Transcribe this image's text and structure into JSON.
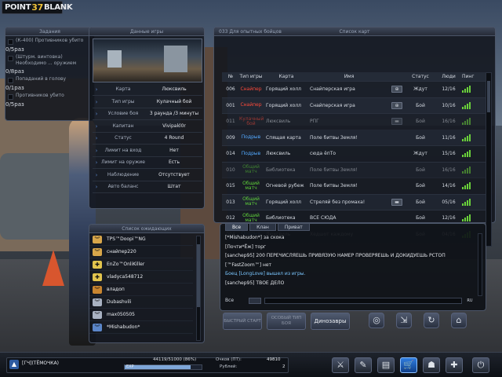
{
  "logo": {
    "left": "POINT",
    "num": "37",
    "right": "BLANK"
  },
  "missions": {
    "header": "Задания",
    "items": [
      {
        "text": "(К-400) Противников убито",
        "progress": "0/5раз"
      },
      {
        "text": "(Штурм. винтовка) Необходимо ... оружием",
        "progress": "0/8раз"
      },
      {
        "text": "Попаданий в голову",
        "progress": "0/1раз"
      },
      {
        "text": "Противников убито",
        "progress": "0/5раз"
      }
    ]
  },
  "gamedata": {
    "header": "Данные игры",
    "rows": [
      {
        "label": "Карта",
        "value": "Люксвиль"
      },
      {
        "label": "Тип игры",
        "value": "Кулачный бой"
      },
      {
        "label": "Условие боя",
        "value": "3 раунда /3 минуты"
      },
      {
        "label": "Капитан",
        "value": "Vivipakl0r"
      },
      {
        "label": "Статус",
        "value": "4 Round"
      },
      {
        "label": "Лимит на вход",
        "value": "Нет"
      },
      {
        "label": "Лимит на оружие",
        "value": "Есть"
      },
      {
        "label": "Наблюдение",
        "value": "Отсутствует"
      },
      {
        "label": "Авто баланс",
        "value": "Штат"
      }
    ]
  },
  "waiting": {
    "header": "Список ожидающих",
    "players": [
      {
        "rank_icon": "chevron-icon",
        "rank_color": "#d8a64a",
        "nick": "TPS™Doopi™NG"
      },
      {
        "rank_icon": "chevron-icon",
        "rank_color": "#d8a64a",
        "nick": "снайпер220"
      },
      {
        "rank_icon": "cross-icon",
        "rank_color": "#e2c44d",
        "nick": "EnZo™OnliKiller"
      },
      {
        "rank_icon": "cross-icon",
        "rank_color": "#e2c44d",
        "nick": "vladyca548712"
      },
      {
        "rank_icon": "chevron-icon",
        "rank_color": "#c9852f",
        "nick": "владоп"
      },
      {
        "rank_icon": "chevron-icon",
        "rank_color": "#a9b2c2",
        "nick": "Dubashvili"
      },
      {
        "rank_icon": "chevron-icon",
        "rank_color": "#a9b2c2",
        "nick": "max050505"
      },
      {
        "rank_icon": "chevron-icon",
        "rank_color": "#5b86c9",
        "nick": "*Mishabudon*"
      }
    ]
  },
  "rooms": {
    "server": "033 Для опытных бойцов",
    "header": "Список карт",
    "columns": [
      "№",
      "Тип игры",
      "Карта",
      "Имя",
      "Статус",
      "Люди",
      "Пинг"
    ],
    "rows": [
      {
        "num": "006",
        "mode": "Снайпер",
        "mode_color": "#ff4a3a",
        "map": "Горящий холл",
        "name": "Снайперская игра",
        "icon": "⊕",
        "status": "Ждут",
        "ppl": "12/16",
        "ping": 4,
        "dim": false
      },
      {
        "num": "001",
        "mode": "Снайпер",
        "mode_color": "#ff4a3a",
        "map": "Горящий холл",
        "name": "Снайперская игра",
        "icon": "⊕",
        "status": "Бой",
        "ppl": "10/16",
        "ping": 4,
        "dim": false
      },
      {
        "num": "011",
        "mode": "Кулачный бой",
        "mode_color": "#ff4a3a",
        "map": "Люксвиль",
        "name": "РПГ",
        "icon": "▬",
        "status": "Бой",
        "ppl": "16/16",
        "ping": 4,
        "dim": true
      },
      {
        "num": "009",
        "mode": "Подрыв",
        "mode_color": "#53a9ff",
        "map": "Спящая карта",
        "name": "Поле битвы Земля!",
        "icon": "",
        "status": "Бой",
        "ppl": "11/16",
        "ping": 4,
        "dim": false
      },
      {
        "num": "014",
        "mode": "Подрыв",
        "mode_color": "#53a9ff",
        "map": "Люксвиль",
        "name": "сюда ёпТо",
        "icon": "",
        "status": "Ждут",
        "ppl": "15/16",
        "ping": 4,
        "dim": false
      },
      {
        "num": "010",
        "mode": "Общий матч",
        "mode_color": "#5fd13a",
        "map": "Библиотека",
        "name": "Поле битвы Земля!",
        "icon": "",
        "status": "Бой",
        "ppl": "16/16",
        "ping": 4,
        "dim": true
      },
      {
        "num": "015",
        "mode": "Общий матч",
        "mode_color": "#5fd13a",
        "map": "Огневой рубеж",
        "name": "Поле битвы Земля!",
        "icon": "",
        "status": "Бой",
        "ppl": "14/16",
        "ping": 4,
        "dim": false
      },
      {
        "num": "013",
        "mode": "Общий матч",
        "mode_color": "#5fd13a",
        "map": "Горящий холл",
        "name": "Стреляй без промаха!",
        "icon": "▬",
        "status": "Бой",
        "ppl": "05/16",
        "ping": 4,
        "dim": false
      },
      {
        "num": "012",
        "mode": "Общий матч",
        "mode_color": "#5fd13a",
        "map": "Библиотека",
        "name": "ВСЕ СЮДА",
        "icon": "",
        "status": "Бой",
        "ppl": "12/16",
        "ping": 4,
        "dim": false
      },
      {
        "num": "004",
        "mode": "Подрыв",
        "mode_color": "#53a9ff",
        "map": "Люксвиль",
        "name": "Хедшот каждому",
        "icon": "",
        "status": "Бой",
        "ppl": "04/16",
        "ping": 4,
        "dim": false
      }
    ]
  },
  "chat": {
    "tabs": [
      "Все",
      "Клан",
      "Приват"
    ],
    "messages": [
      {
        "text": "[*Mishabudon*] за скока",
        "sys": false
      },
      {
        "text": "[Почти*Ёж] торг",
        "sys": false
      },
      {
        "text": "[sanchep95] 200 ПЕРЕЧИСЛЯЕШЬ ПРИВЯЗУЮ НАМЕР ПРОВЕРЯЕШЬ И ДОКИДУЕШЬ РСТОП",
        "sys": false
      },
      {
        "text": "[™FastZoom™] нет",
        "sys": false
      },
      {
        "text": "Боец [LongLove] вышел из игры.",
        "sys": true
      },
      {
        "text": "[sanchep95] ТВОЕ ДЕЛО",
        "sys": false
      }
    ],
    "channel": "Все",
    "lang": "RU"
  },
  "buttons": {
    "quick_start": "БЫСТРЫЙ СТАРТ",
    "special_mode": "ОСОБЫЙ ТИП БОЯ",
    "dinosaurs": "Динозавры"
  },
  "player": {
    "name": "[ГЧ](ТЁМОЧКА)",
    "xp": "44119/51000 (86%)",
    "exp_label": "EXP",
    "exp_fraction": 0.86,
    "points_label": "Очков (ПТ):",
    "points": "49810",
    "rubles_label": "Рублей:",
    "rubles": "2"
  }
}
